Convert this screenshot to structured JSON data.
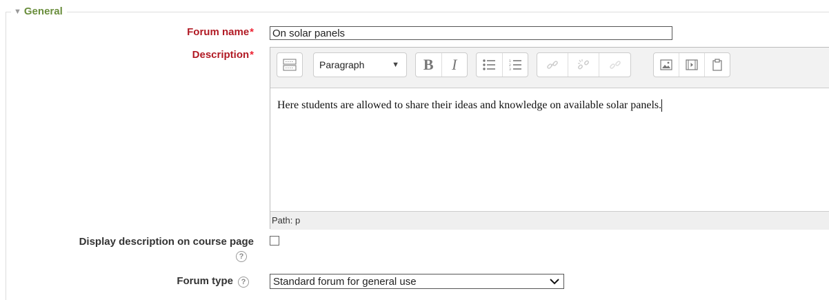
{
  "section": {
    "title": "General"
  },
  "forum_name": {
    "label": "Forum name",
    "value": "On solar panels"
  },
  "description": {
    "label": "Description",
    "format_select": "Paragraph",
    "content": "Here students are allowed to share their ideas and knowledge on available solar panels.",
    "path": "Path: p"
  },
  "display_description": {
    "label": "Display description on course page",
    "checked": false
  },
  "forum_type": {
    "label": "Forum type",
    "value": "Standard forum for general use"
  },
  "colors": {
    "legend": "#6a8e3d",
    "required_label": "#b11a24",
    "required_star": "#ee2233"
  }
}
